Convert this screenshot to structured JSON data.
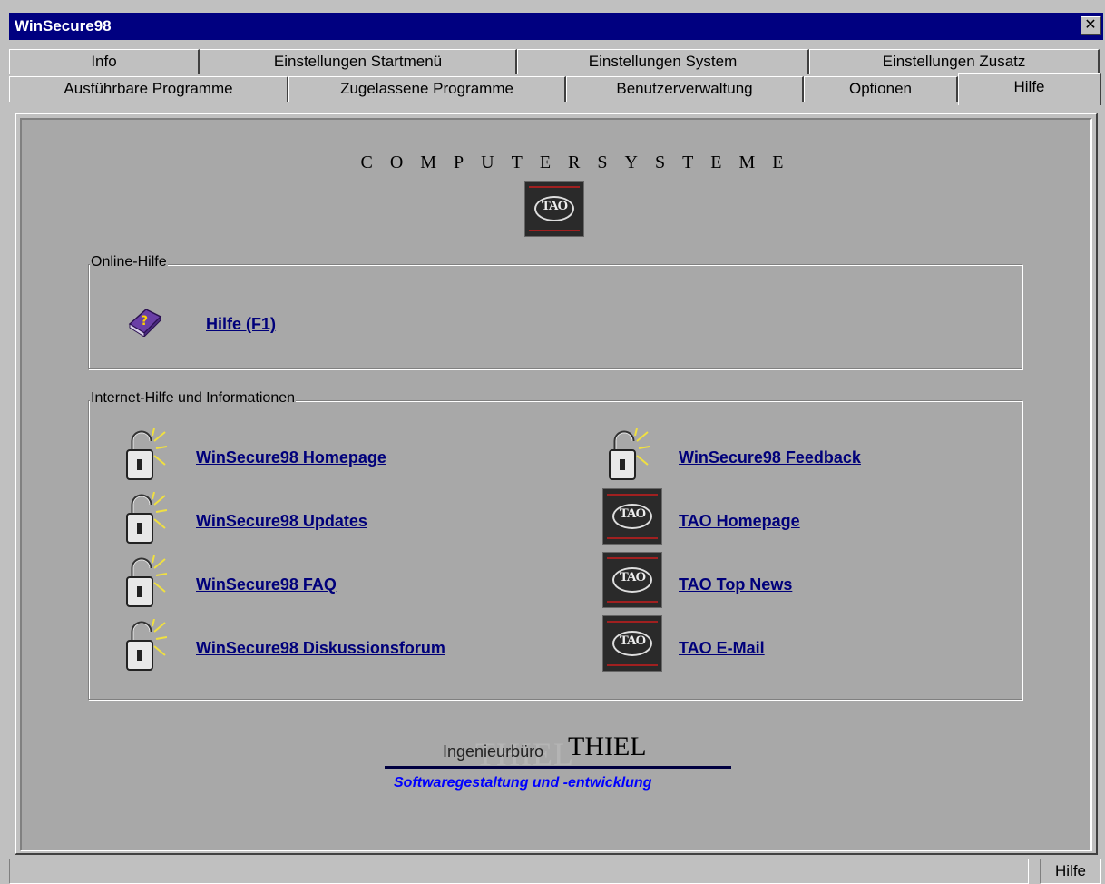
{
  "window": {
    "title": "WinSecure98",
    "close_glyph": "✕"
  },
  "tabs_row1": [
    "Info",
    "Einstellungen Startmenü",
    "Einstellungen System",
    "Einstellungen Zusatz"
  ],
  "tabs_row2": [
    "Ausführbare Programme",
    "Zugelassene Programme",
    "Benutzerverwaltung",
    "Optionen",
    "Hilfe"
  ],
  "active_tab": "Hilfe",
  "panel": {
    "heading": "COMPUTERSYSTEME",
    "logo_text": "TAO"
  },
  "online_help": {
    "legend": "Online-Hilfe",
    "link": "Hilfe (F1)",
    "icon": "help-book-icon"
  },
  "internet_help": {
    "legend": "Internet-Hilfe und Informationen",
    "left_links": [
      "WinSecure98 Homepage",
      "WinSecure98 Updates",
      "WinSecure98 FAQ",
      "WinSecure98 Diskussionsforum"
    ],
    "right_links": [
      "WinSecure98 Feedback",
      "TAO Homepage",
      "TAO Top News",
      "TAO E-Mail"
    ],
    "left_icon": "padlock-icon",
    "right_icons": [
      "padlock-icon",
      "tao-logo-icon",
      "tao-logo-icon",
      "tao-logo-icon"
    ]
  },
  "brand": {
    "ghost": "THIEL",
    "prefix": "Ingenieurbüro",
    "name": "THIEL",
    "tagline": "Softwaregestaltung und -entwicklung"
  },
  "statusbar": {
    "right_label": "Hilfe"
  },
  "colors": {
    "titlebar": "#000080",
    "link": "#00007a",
    "tagline": "#0000ff",
    "panel_bg": "#a8a8a8"
  }
}
